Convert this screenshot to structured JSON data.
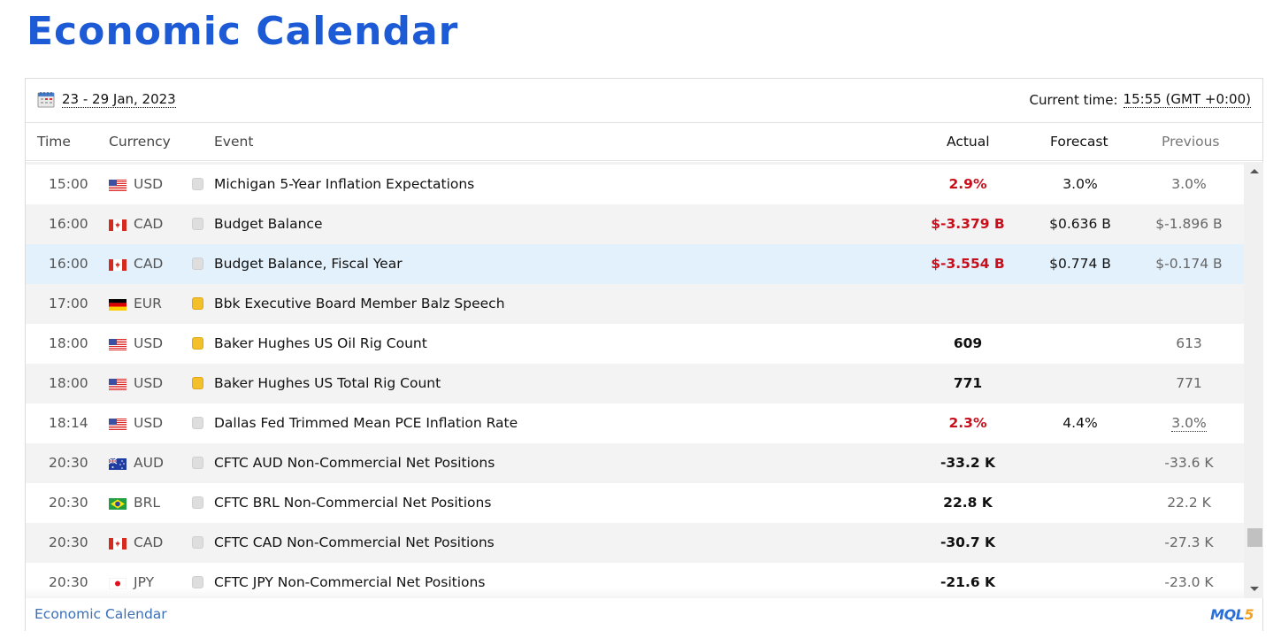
{
  "page": {
    "title": "Economic Calendar"
  },
  "widget": {
    "date_range": "23 - 29 Jan, 2023",
    "current_time_label": "Current time:",
    "current_time_value": "15:55 (GMT +0:00)",
    "columns": {
      "time": "Time",
      "currency": "Currency",
      "event": "Event",
      "actual": "Actual",
      "forecast": "Forecast",
      "previous": "Previous"
    },
    "rows": [
      {
        "time": "15:00",
        "flag": "us-flag-icon",
        "currency": "USD",
        "importance": "low",
        "event": "Michigan 5-Year Inflation Expectations",
        "actual": "2.9%",
        "actual_negative": true,
        "forecast": "3.0%",
        "previous": "3.0%",
        "previous_revised": false
      },
      {
        "time": "16:00",
        "flag": "ca-flag-icon",
        "currency": "CAD",
        "importance": "low",
        "event": "Budget Balance",
        "actual": "$-3.379 B",
        "actual_negative": true,
        "forecast": "$0.636 B",
        "previous": "$-1.896 B",
        "previous_revised": false
      },
      {
        "time": "16:00",
        "flag": "ca-flag-icon",
        "currency": "CAD",
        "importance": "low",
        "event": "Budget Balance, Fiscal Year",
        "actual": "$-3.554 B",
        "actual_negative": true,
        "forecast": "$0.774 B",
        "previous": "$-0.174 B",
        "previous_revised": false,
        "highlighted": true
      },
      {
        "time": "17:00",
        "flag": "de-flag-icon",
        "currency": "EUR",
        "importance": "medium",
        "event": "Bbk Executive Board Member Balz Speech",
        "actual": "",
        "actual_negative": false,
        "forecast": "",
        "previous": "",
        "previous_revised": false
      },
      {
        "time": "18:00",
        "flag": "us-flag-icon",
        "currency": "USD",
        "importance": "medium",
        "event": "Baker Hughes US Oil Rig Count",
        "actual": "609",
        "actual_negative": false,
        "forecast": "",
        "previous": "613",
        "previous_revised": false
      },
      {
        "time": "18:00",
        "flag": "us-flag-icon",
        "currency": "USD",
        "importance": "medium",
        "event": "Baker Hughes US Total Rig Count",
        "actual": "771",
        "actual_negative": false,
        "forecast": "",
        "previous": "771",
        "previous_revised": false
      },
      {
        "time": "18:14",
        "flag": "us-flag-icon",
        "currency": "USD",
        "importance": "low",
        "event": "Dallas Fed Trimmed Mean PCE Inflation Rate",
        "actual": "2.3%",
        "actual_negative": true,
        "forecast": "4.4%",
        "previous": "3.0%",
        "previous_revised": true
      },
      {
        "time": "20:30",
        "flag": "au-flag-icon",
        "currency": "AUD",
        "importance": "low",
        "event": "CFTC AUD Non-Commercial Net Positions",
        "actual": "-33.2 K",
        "actual_negative": false,
        "forecast": "",
        "previous": "-33.6 K",
        "previous_revised": false
      },
      {
        "time": "20:30",
        "flag": "br-flag-icon",
        "currency": "BRL",
        "importance": "low",
        "event": "CFTC BRL Non-Commercial Net Positions",
        "actual": "22.8 K",
        "actual_negative": false,
        "forecast": "",
        "previous": "22.2 K",
        "previous_revised": false
      },
      {
        "time": "20:30",
        "flag": "ca-flag-icon",
        "currency": "CAD",
        "importance": "low",
        "event": "CFTC CAD Non-Commercial Net Positions",
        "actual": "-30.7 K",
        "actual_negative": false,
        "forecast": "",
        "previous": "-27.3 K",
        "previous_revised": false
      },
      {
        "time": "20:30",
        "flag": "jp-flag-icon",
        "currency": "JPY",
        "importance": "low",
        "event": "CFTC JPY Non-Commercial Net Positions",
        "actual": "-21.6 K",
        "actual_negative": false,
        "forecast": "",
        "previous": "-23.0 K",
        "previous_revised": false
      }
    ],
    "footer": {
      "link": "Economic Calendar",
      "logo_main": "MQL",
      "logo_accent": "5"
    },
    "colors": {
      "title": "#1d5bd6",
      "negative": "#c8101d",
      "medium_importance": "#f4c02a",
      "low_importance": "#dedede",
      "highlight_row": "#e3f1fc",
      "link": "#3b6fb6"
    }
  }
}
